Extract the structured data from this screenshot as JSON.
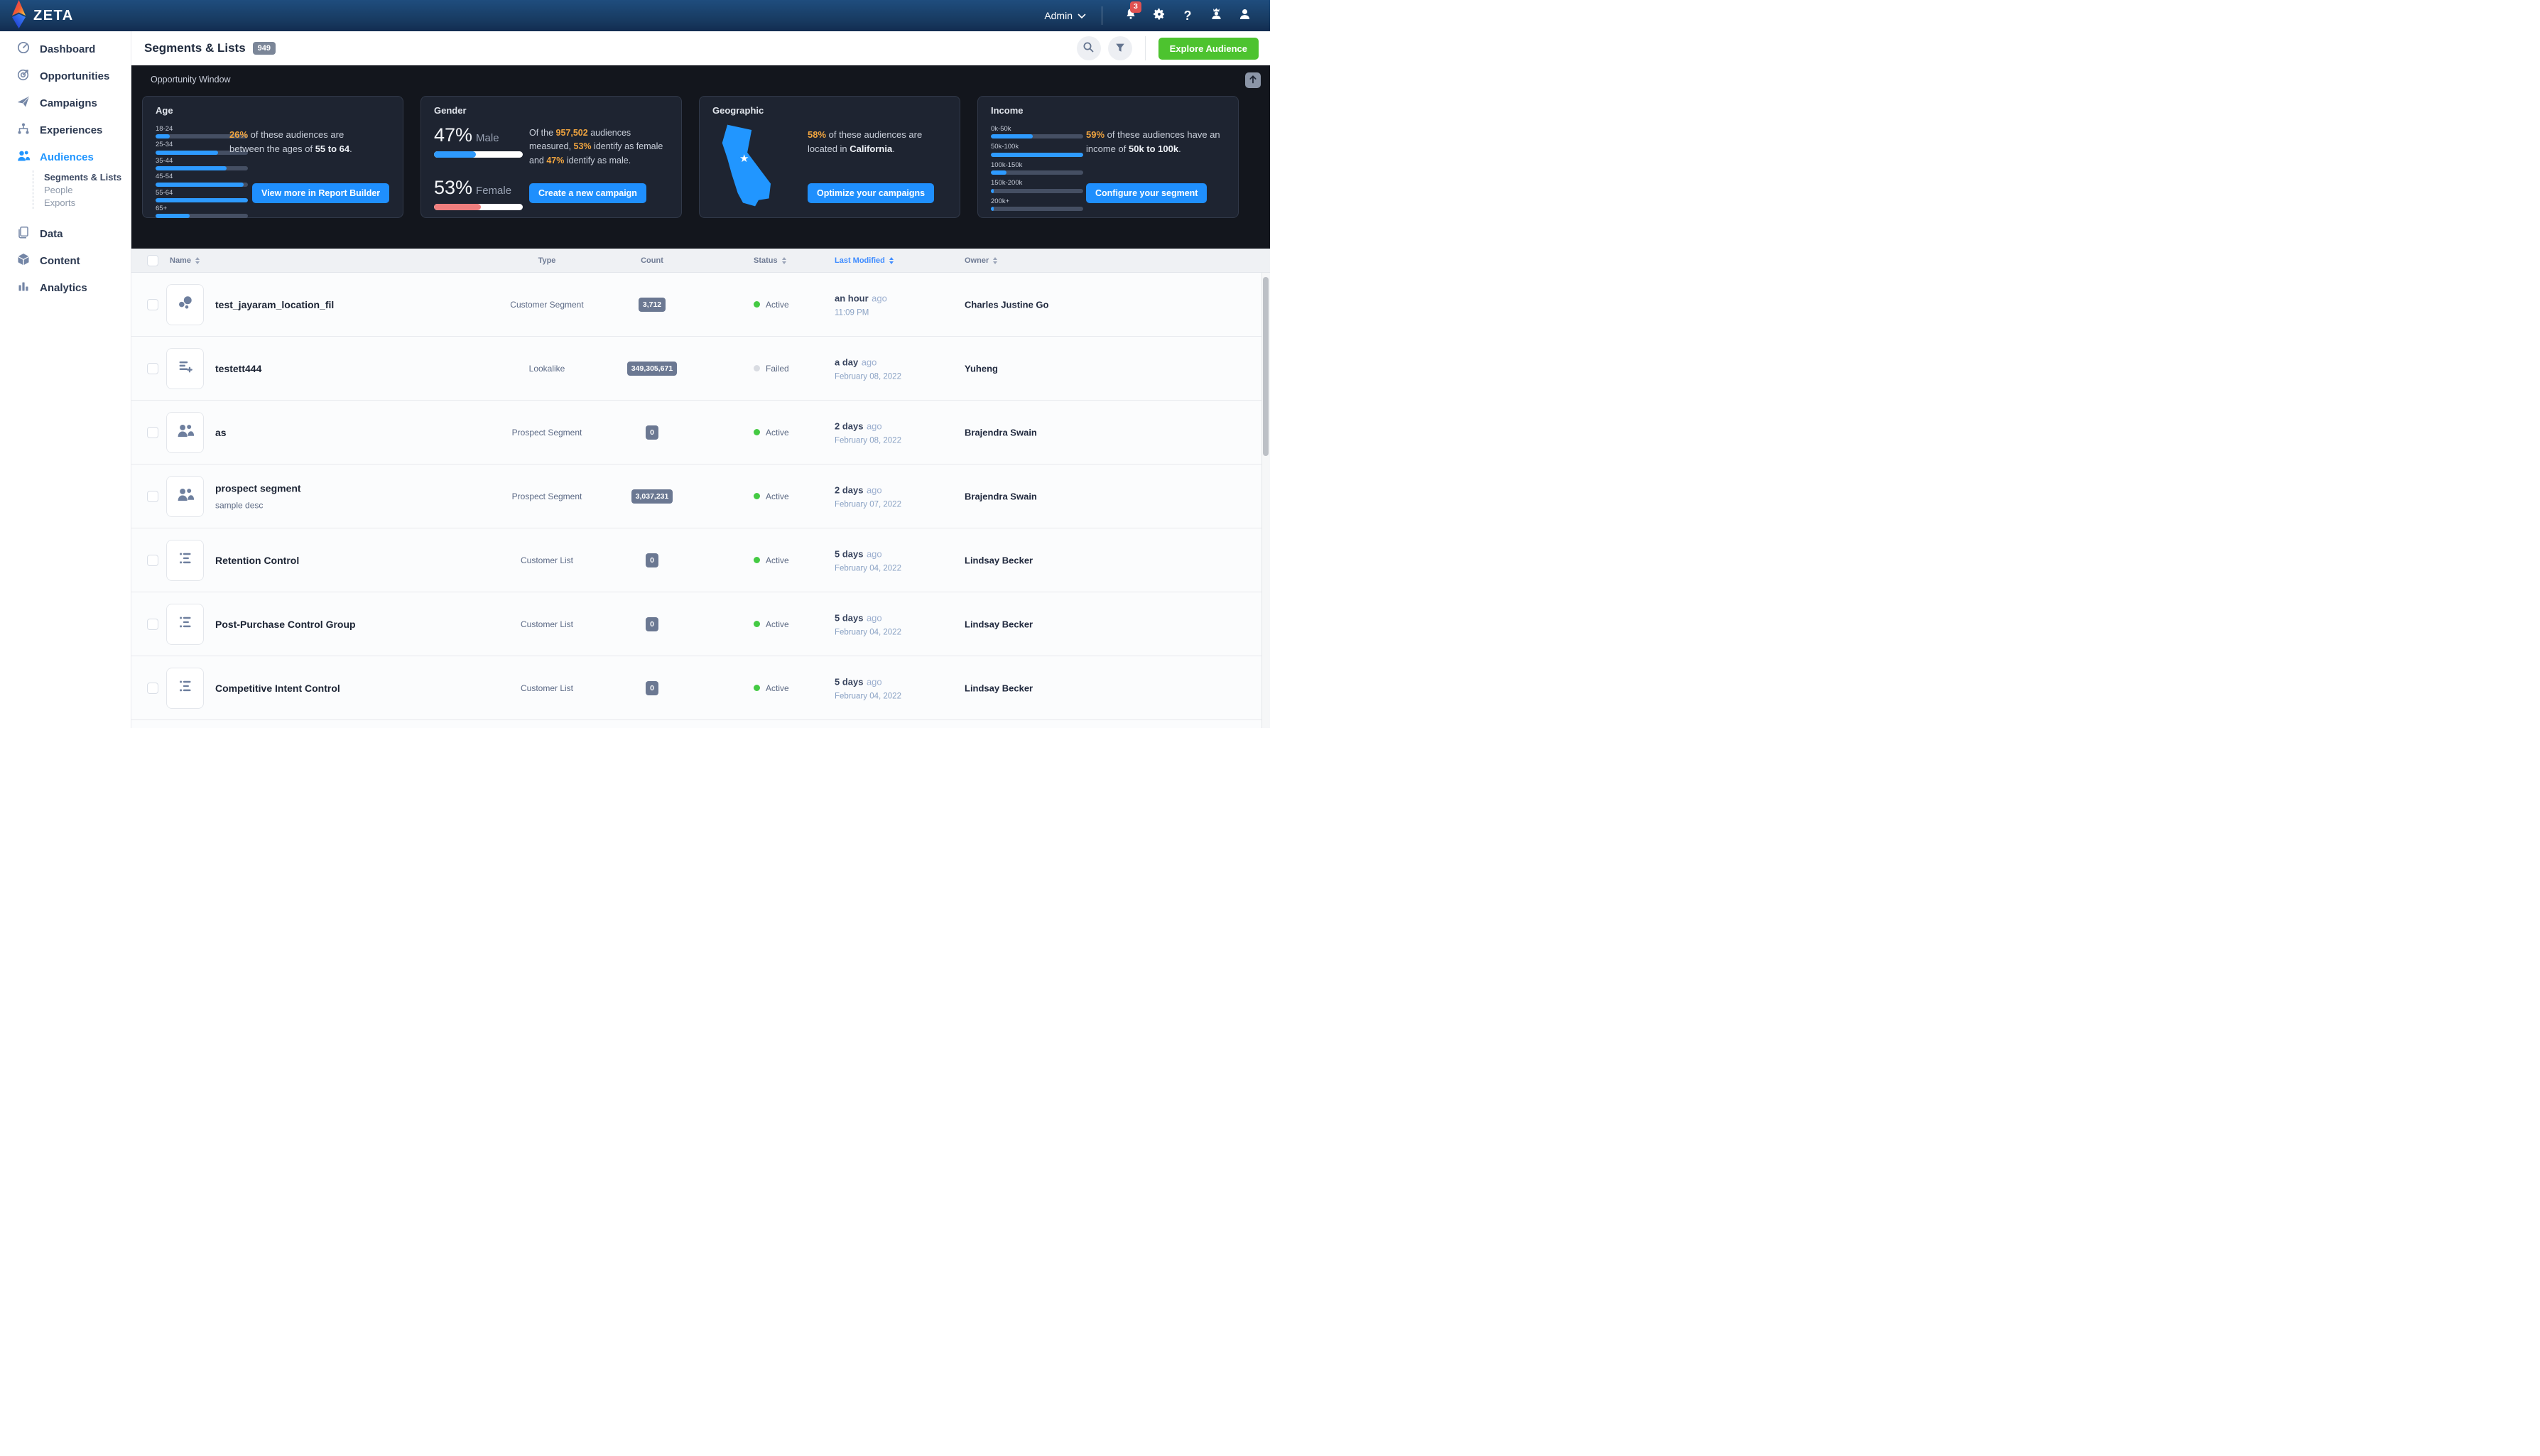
{
  "colors": {
    "accent_blue": "#2196ff",
    "button_blue": "#1f8ffd",
    "success_green": "#44ca43",
    "failed_gray": "#d9dce2",
    "highlight_orange": "#f0a43f",
    "female_pink": "#ef7e7e",
    "notification_red": "#e05252",
    "explore_green": "#4dc32f"
  },
  "navbar": {
    "brand": "ZETA",
    "admin_label": "Admin",
    "notification_count": "3"
  },
  "sidebar": {
    "items": [
      {
        "label": "Dashboard"
      },
      {
        "label": "Opportunities"
      },
      {
        "label": "Campaigns"
      },
      {
        "label": "Experiences"
      },
      {
        "label": "Audiences"
      },
      {
        "label": "Data"
      },
      {
        "label": "Content"
      },
      {
        "label": "Analytics"
      }
    ],
    "audiences_children": [
      {
        "label": "Segments & Lists"
      },
      {
        "label": "People"
      },
      {
        "label": "Exports"
      }
    ]
  },
  "page_header": {
    "title": "Segments & Lists",
    "count_badge": "949",
    "explore_button": "Explore Audience"
  },
  "opportunity": {
    "section_label": "Opportunity Window",
    "age": {
      "title": "Age",
      "type": "bar",
      "labels": [
        "18-24",
        "25-34",
        "35-44",
        "45-54",
        "55-64",
        "65+"
      ],
      "values": [
        15,
        68,
        77,
        95,
        100,
        37
      ],
      "highlight": "26%",
      "text_mid": " of these audiences are between the ages of ",
      "strong": "55 to 64",
      "text_end": ".",
      "button": "View more in Report Builder"
    },
    "gender": {
      "title": "Gender",
      "male_pct": "47%",
      "male_label": "Male",
      "male_value": 47,
      "female_pct": "53%",
      "female_label": "Female",
      "female_value": 53,
      "text": {
        "t1": "Of the ",
        "t2": "957,502",
        "t3": " audiences measured, ",
        "t4": "53%",
        "t5": " identify as female and ",
        "t6": "47%",
        "t7": " identify as male."
      },
      "button": "Create a new campaign"
    },
    "geographic": {
      "title": "Geographic",
      "highlight": "58%",
      "text_mid": " of these audiences are located in ",
      "strong": "California",
      "text_end": ".",
      "button": "Optimize your campaigns"
    },
    "income": {
      "title": "Income",
      "type": "bar",
      "labels": [
        "0k-50k",
        "50k-100k",
        "100k-150k",
        "150k-200k",
        "200k+"
      ],
      "values": [
        45,
        100,
        17,
        3,
        3
      ],
      "highlight": "59%",
      "text_mid": " of these audiences have an income of ",
      "strong": "50k to 100k",
      "text_end": ".",
      "button": "Configure your segment"
    }
  },
  "table": {
    "header": {
      "name": "Name",
      "type": "Type",
      "count": "Count",
      "status": "Status",
      "last_modified": "Last Modified",
      "owner": "Owner"
    },
    "rows": [
      {
        "icon": "bubble-chart-icon",
        "name": "test_jayaram_location_fil",
        "type": "Customer Segment",
        "count": "3,712",
        "status": "Active",
        "modified_rel": "an hour",
        "modified_ago": "ago",
        "modified_detail": "11:09 PM",
        "owner": "Charles Justine Go"
      },
      {
        "icon": "list-add-icon",
        "name": "testett444",
        "type": "Lookalike",
        "count": "349,305,671",
        "status": "Failed",
        "modified_rel": "a day",
        "modified_ago": "ago",
        "modified_detail": "February 08, 2022",
        "owner": "Yuheng"
      },
      {
        "icon": "people-icon",
        "name": "as",
        "type": "Prospect Segment",
        "count": "0",
        "status": "Active",
        "modified_rel": "2 days",
        "modified_ago": "ago",
        "modified_detail": "February 08, 2022",
        "owner": "Brajendra Swain"
      },
      {
        "icon": "people-icon",
        "name": "prospect segment",
        "desc": "sample desc",
        "type": "Prospect Segment",
        "count": "3,037,231",
        "status": "Active",
        "modified_rel": "2 days",
        "modified_ago": "ago",
        "modified_detail": "February 07, 2022",
        "owner": "Brajendra Swain"
      },
      {
        "icon": "list-icon",
        "name": "Retention Control",
        "type": "Customer List",
        "count": "0",
        "status": "Active",
        "modified_rel": "5 days",
        "modified_ago": "ago",
        "modified_detail": "February 04, 2022",
        "owner": "Lindsay Becker"
      },
      {
        "icon": "list-icon",
        "name": "Post-Purchase Control Group",
        "type": "Customer List",
        "count": "0",
        "status": "Active",
        "modified_rel": "5 days",
        "modified_ago": "ago",
        "modified_detail": "February 04, 2022",
        "owner": "Lindsay Becker"
      },
      {
        "icon": "list-icon",
        "name": "Competitive Intent Control",
        "type": "Customer List",
        "count": "0",
        "status": "Active",
        "modified_rel": "5 days",
        "modified_ago": "ago",
        "modified_detail": "February 04, 2022",
        "owner": "Lindsay Becker"
      }
    ]
  }
}
